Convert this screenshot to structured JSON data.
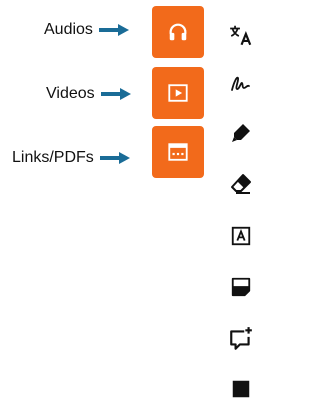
{
  "callouts": [
    {
      "label": "Audios",
      "icon": "arrow-right-icon"
    },
    {
      "label": "Videos",
      "icon": "arrow-right-icon"
    },
    {
      "label": "Links/PDFs",
      "icon": "arrow-right-icon"
    }
  ],
  "media_buttons": [
    {
      "name": "audio",
      "icon": "headphones-icon"
    },
    {
      "name": "video",
      "icon": "play-icon"
    },
    {
      "name": "links-pdfs",
      "icon": "browser-window-icon"
    }
  ],
  "toolbar": [
    {
      "icon": "translate-icon"
    },
    {
      "icon": "draw-signature-icon"
    },
    {
      "icon": "highlighter-icon"
    },
    {
      "icon": "eraser-icon"
    },
    {
      "icon": "text-box-icon"
    },
    {
      "icon": "note-icon"
    },
    {
      "icon": "add-comment-icon"
    },
    {
      "icon": "filled-square-icon"
    }
  ],
  "colors": {
    "accent": "#f26a1b",
    "arrow": "#1a6c97",
    "icon": "#111111"
  }
}
